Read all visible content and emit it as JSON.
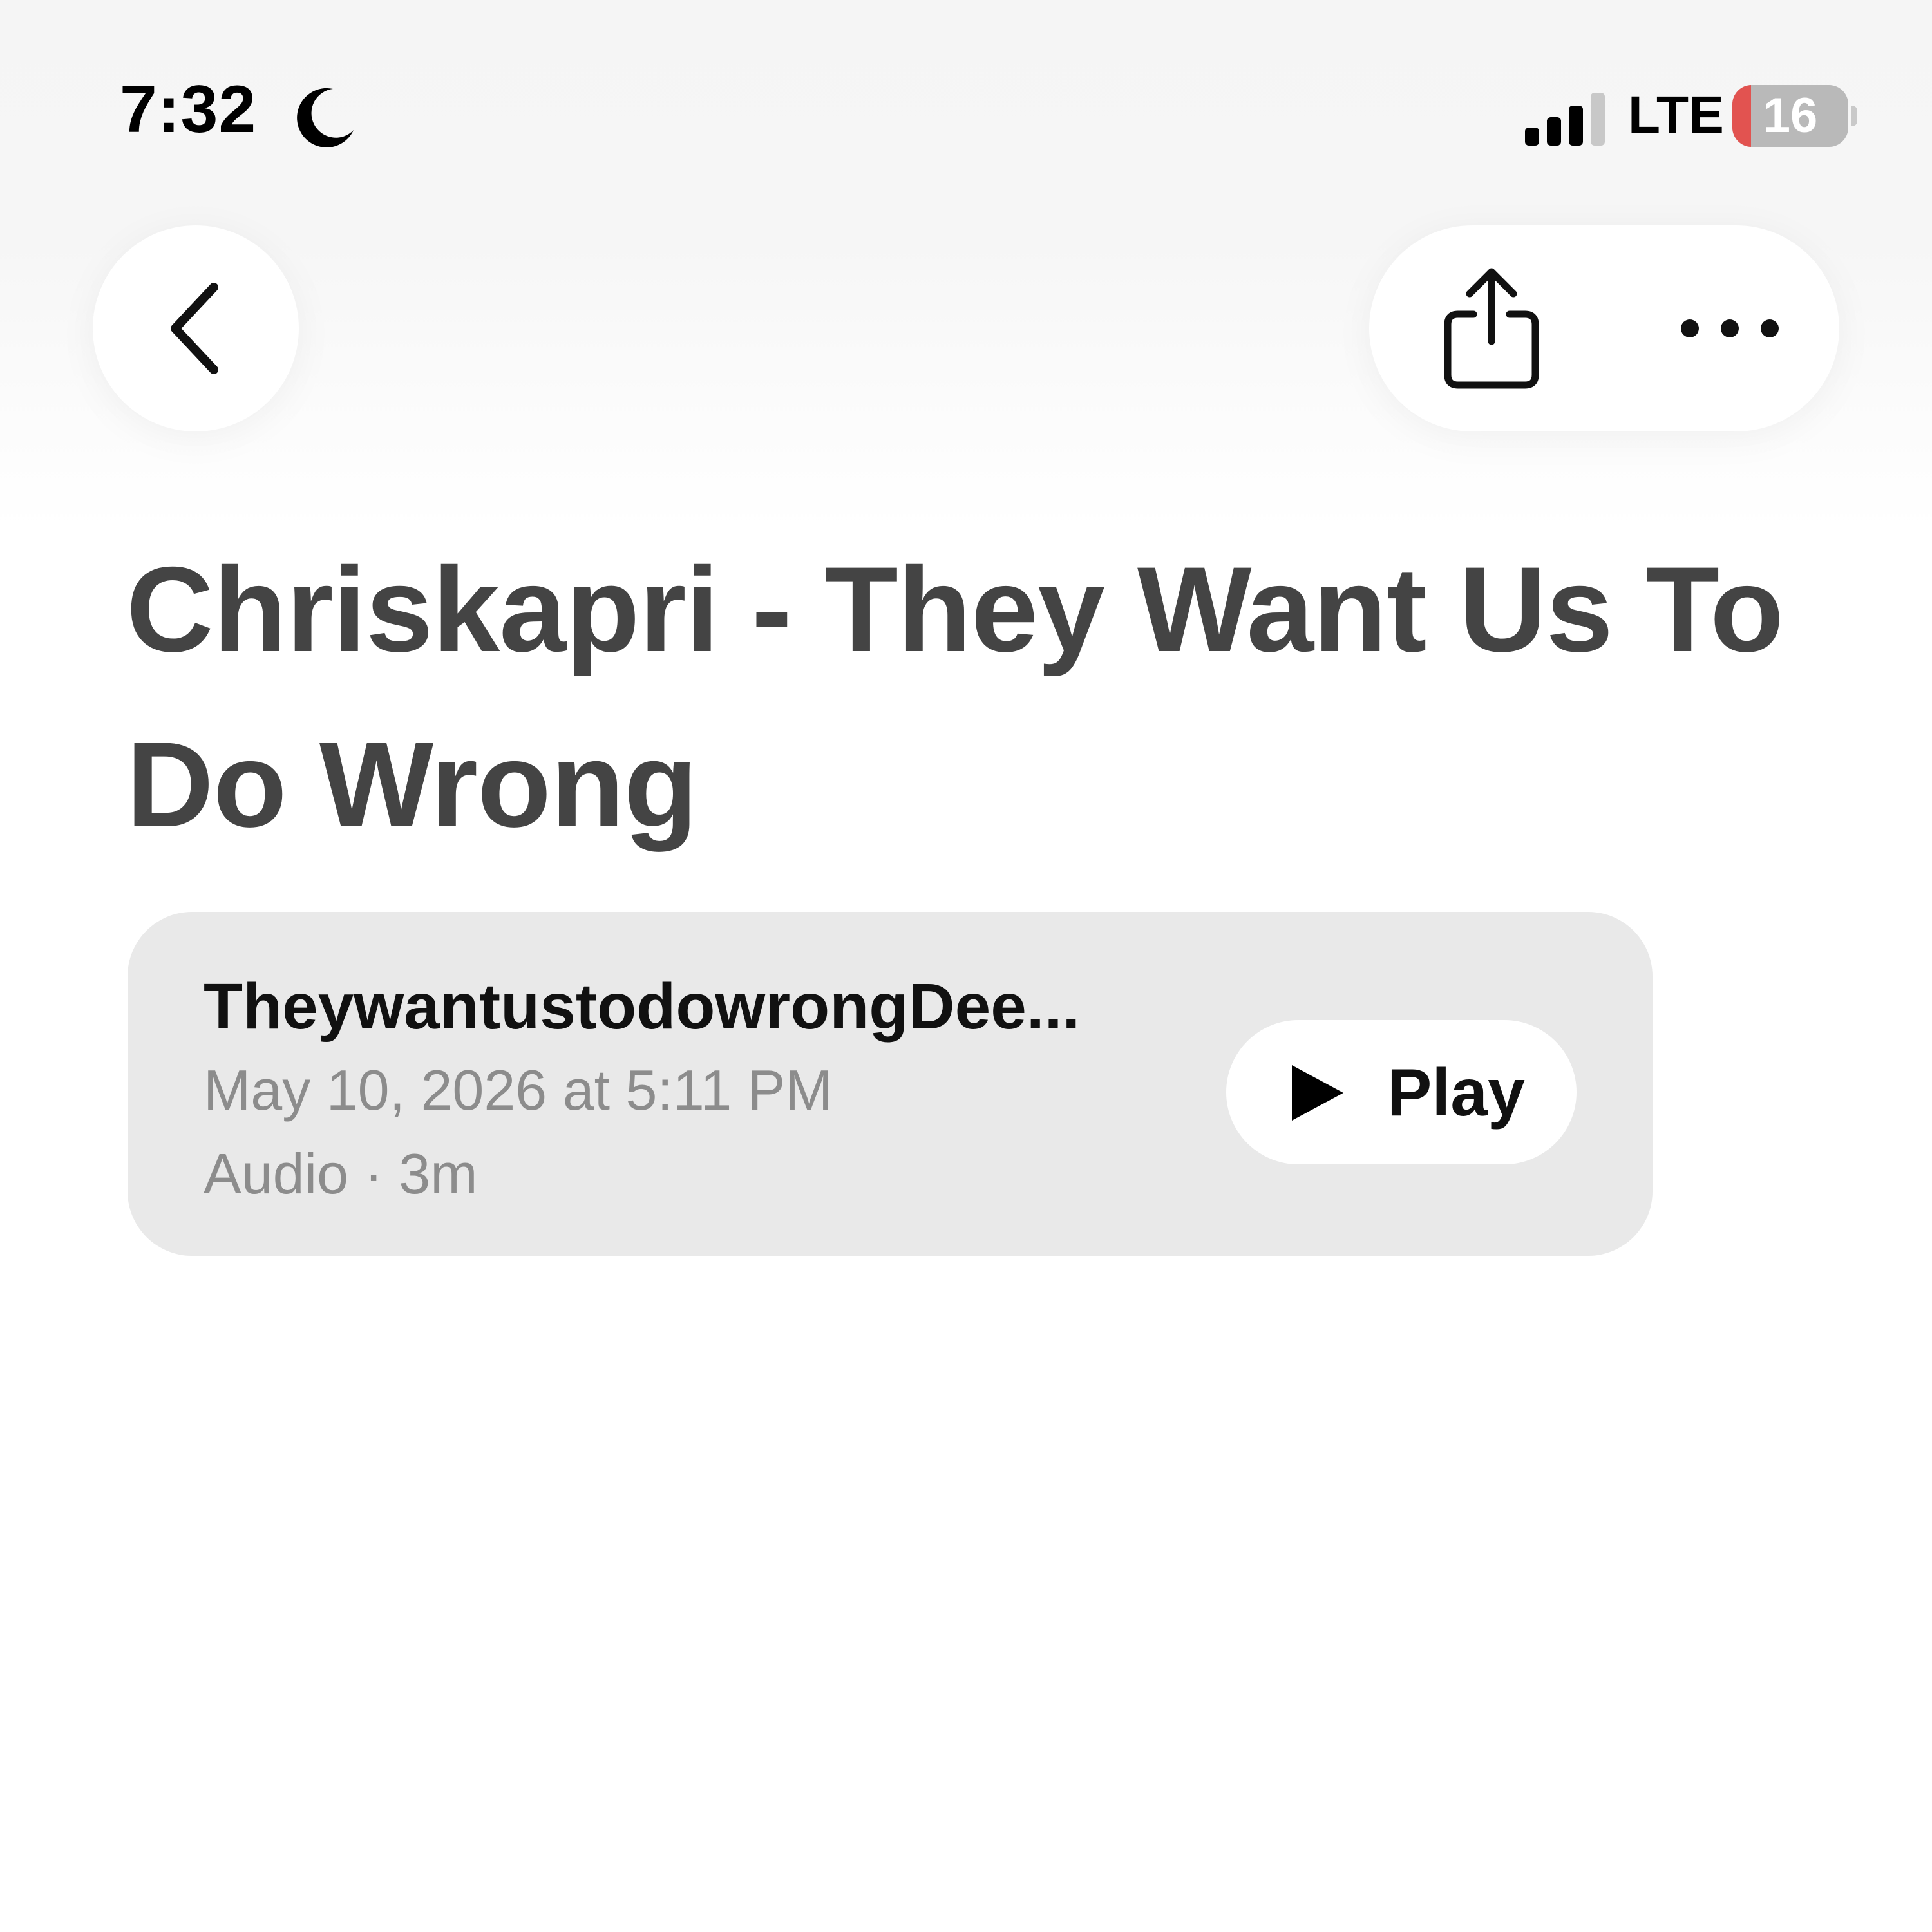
{
  "status_bar": {
    "time": "7:32",
    "network": "LTE",
    "battery_level": "16",
    "battery_fraction": 0.16,
    "icons": [
      "moon-icon",
      "signal-icon",
      "battery-icon"
    ]
  },
  "nav": {
    "back_icon": "chevron-left-icon",
    "share_icon": "share-icon",
    "more_icon": "ellipsis-icon"
  },
  "note": {
    "title": "Chriskapri - They Want Us To Do Wrong"
  },
  "attachment": {
    "file_name": "TheywantustodowrongDee...",
    "date": "May 10, 2026 at 5:11 PM",
    "meta": "Audio · 3m",
    "play_label": "Play",
    "play_icon": "play-icon"
  },
  "colors": {
    "title": "#444444",
    "card_background": "#e9e9e9",
    "battery_low": "#e25350",
    "secondary_text": "#8c8c8c"
  }
}
